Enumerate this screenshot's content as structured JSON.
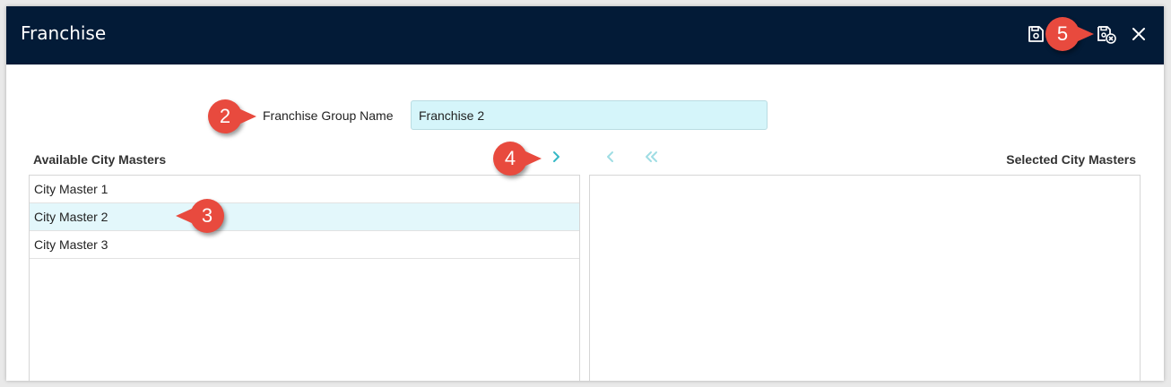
{
  "window": {
    "title": "Franchise"
  },
  "toolbar": {
    "icons": [
      "save-icon",
      "save-and-close-icon",
      "close-icon"
    ]
  },
  "form": {
    "group_name_label": "Franchise Group Name",
    "group_name_value": "Franchise 2"
  },
  "available": {
    "title": "Available City Masters",
    "items": [
      {
        "label": "City Master 1",
        "selected": false
      },
      {
        "label": "City Master 2",
        "selected": true
      },
      {
        "label": "City Master 3",
        "selected": false
      }
    ]
  },
  "selected": {
    "title": "Selected City Masters",
    "items": []
  },
  "transfer_icons": [
    "move-right-icon",
    "move-left-icon",
    "move-all-left-icon"
  ],
  "callouts": [
    "2",
    "3",
    "4",
    "5"
  ],
  "colors": {
    "titlebar": "#031b37",
    "callout": "#e84a3e",
    "accent": "#35b8c6",
    "input_bg": "#d5f5fa",
    "selected_row": "#e3f7fb"
  }
}
